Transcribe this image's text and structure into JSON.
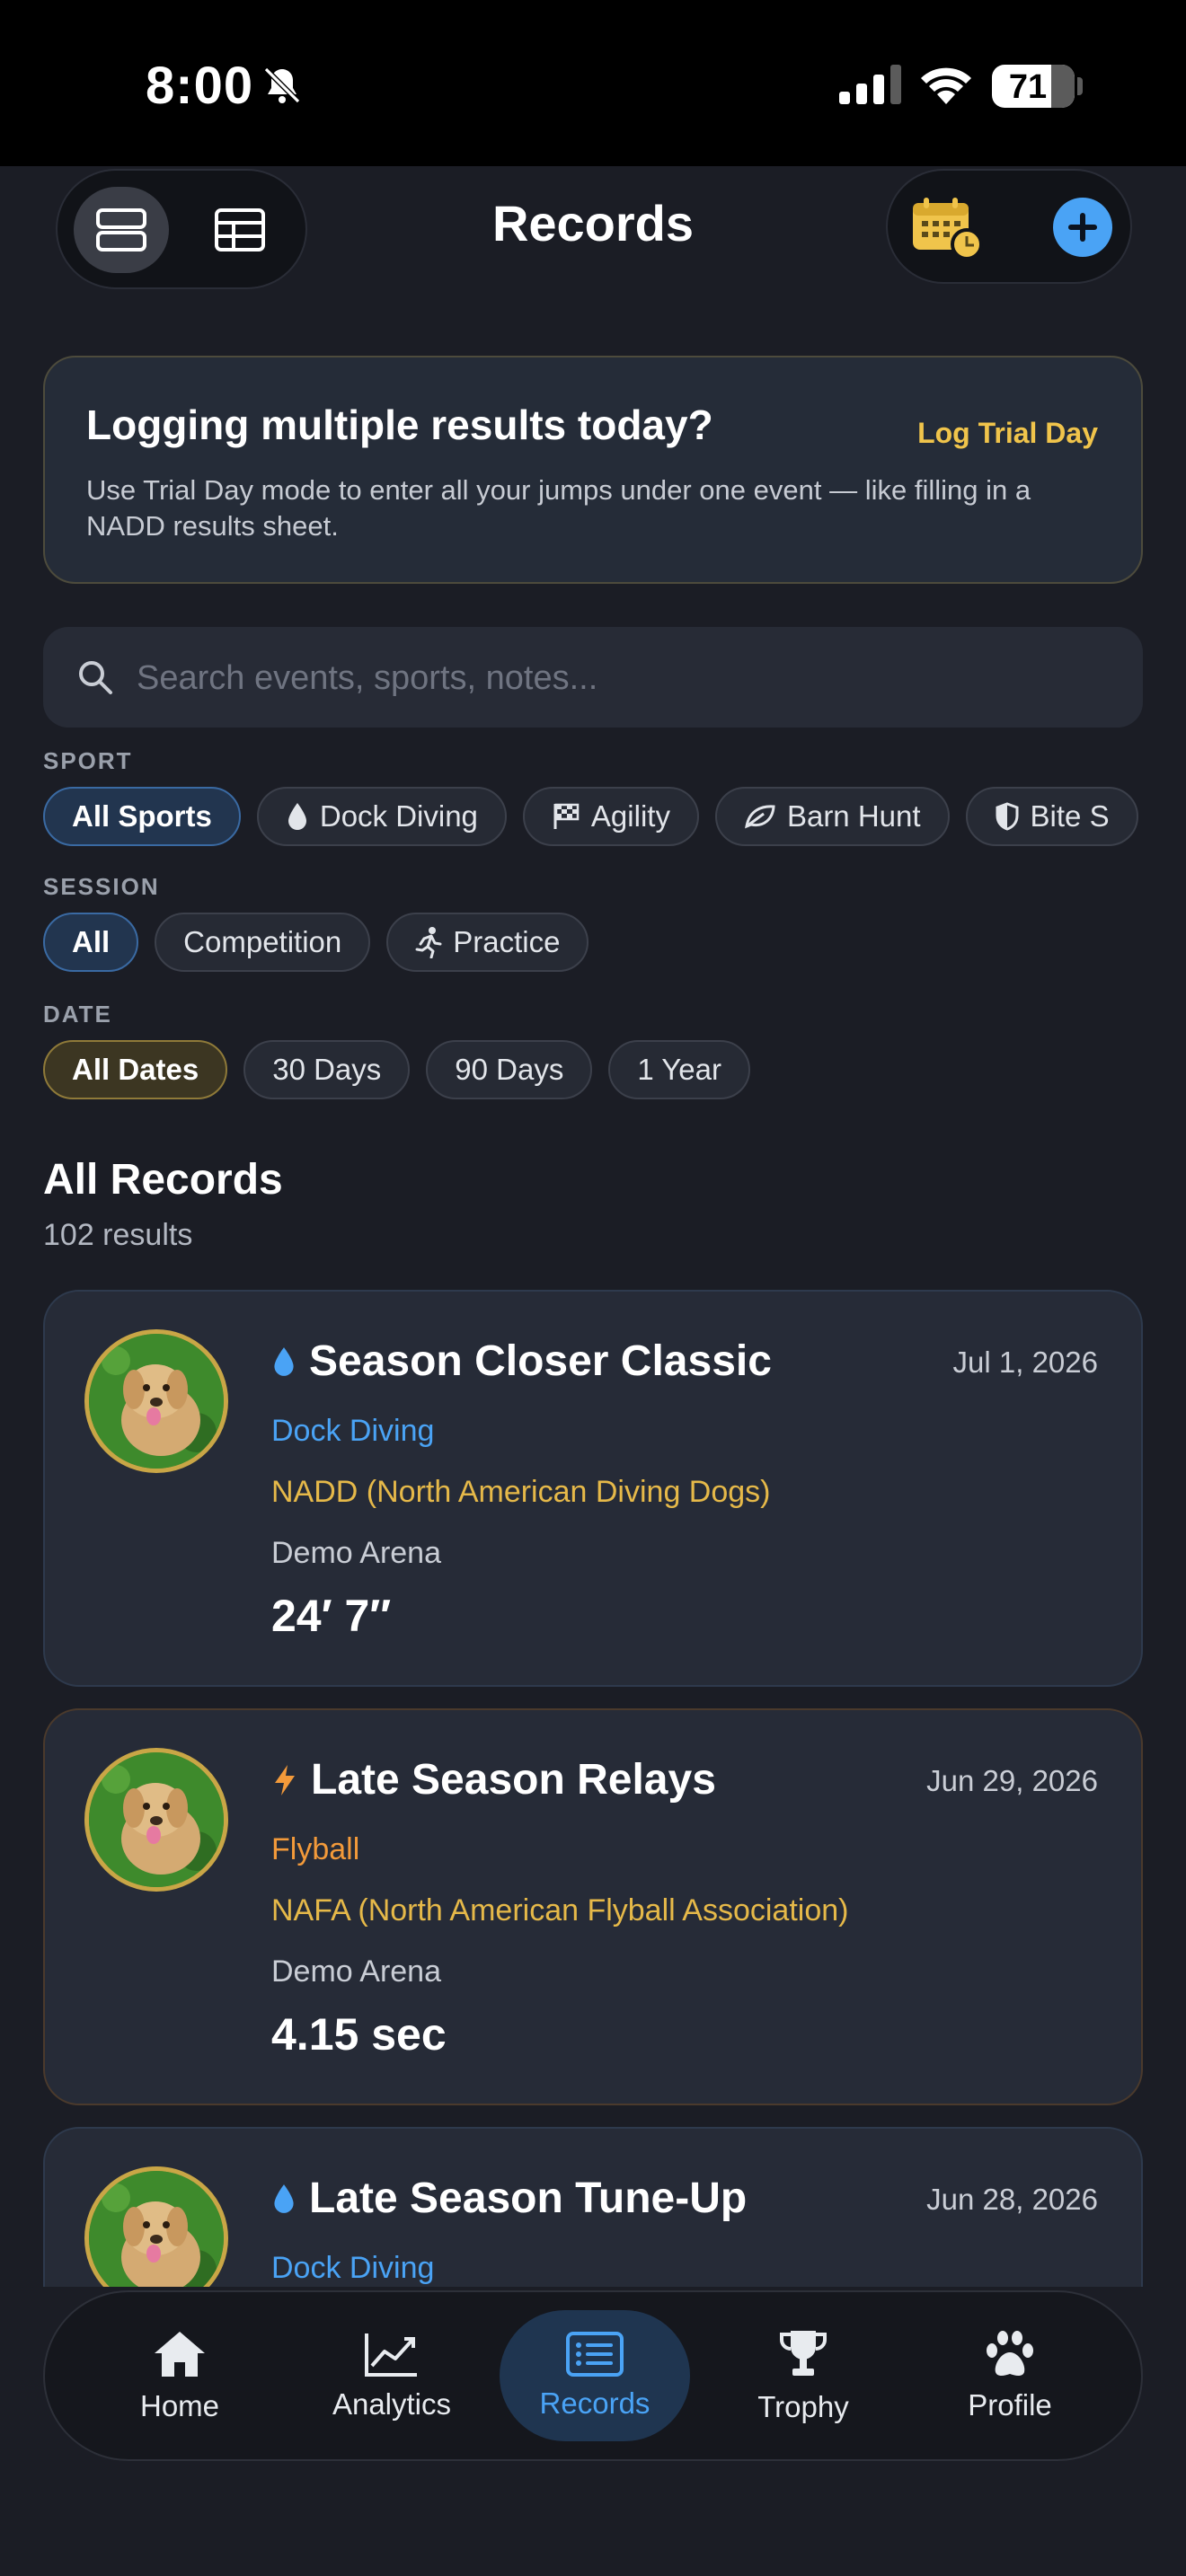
{
  "status_bar": {
    "time": "8:00",
    "battery": "71"
  },
  "header": {
    "title": "Records"
  },
  "banner": {
    "title": "Logging multiple results today?",
    "action": "Log Trial Day",
    "body": "Use Trial Day mode to enter all your jumps under one event — like filling in a NADD results sheet."
  },
  "search": {
    "placeholder": "Search events, sports, notes..."
  },
  "filters": {
    "sport_label": "SPORT",
    "sport": [
      "All Sports",
      "Dock Diving",
      "Agility",
      "Barn Hunt",
      "Bite S"
    ],
    "session_label": "SESSION",
    "session": [
      "All",
      "Competition",
      "Practice"
    ],
    "date_label": "DATE",
    "date": [
      "All Dates",
      "30 Days",
      "90 Days",
      "1 Year"
    ]
  },
  "list": {
    "title": "All Records",
    "count": "102 results"
  },
  "records": [
    {
      "name": "Season Closer Classic",
      "date": "Jul 1, 2026",
      "sport": "Dock Diving",
      "org": "NADD (North American Diving Dogs)",
      "venue": "Demo Arena",
      "result": "24′ 7″"
    },
    {
      "name": "Late Season Relays",
      "date": "Jun 29, 2026",
      "sport": "Flyball",
      "org": "NAFA (North American Flyball Association)",
      "venue": "Demo Arena",
      "result": "4.15 sec"
    },
    {
      "name": "Late Season Tune-Up",
      "date": "Jun 28, 2026",
      "sport": "Dock Diving",
      "org": "",
      "venue": "",
      "result": ""
    }
  ],
  "tabs": [
    "Home",
    "Analytics",
    "Records",
    "Trophy",
    "Profile"
  ],
  "colors": {
    "accent_blue": "#4aa3f5",
    "gold": "#f0c44b",
    "flyball_orange": "#f39a3a",
    "background": "#1b1d25"
  }
}
